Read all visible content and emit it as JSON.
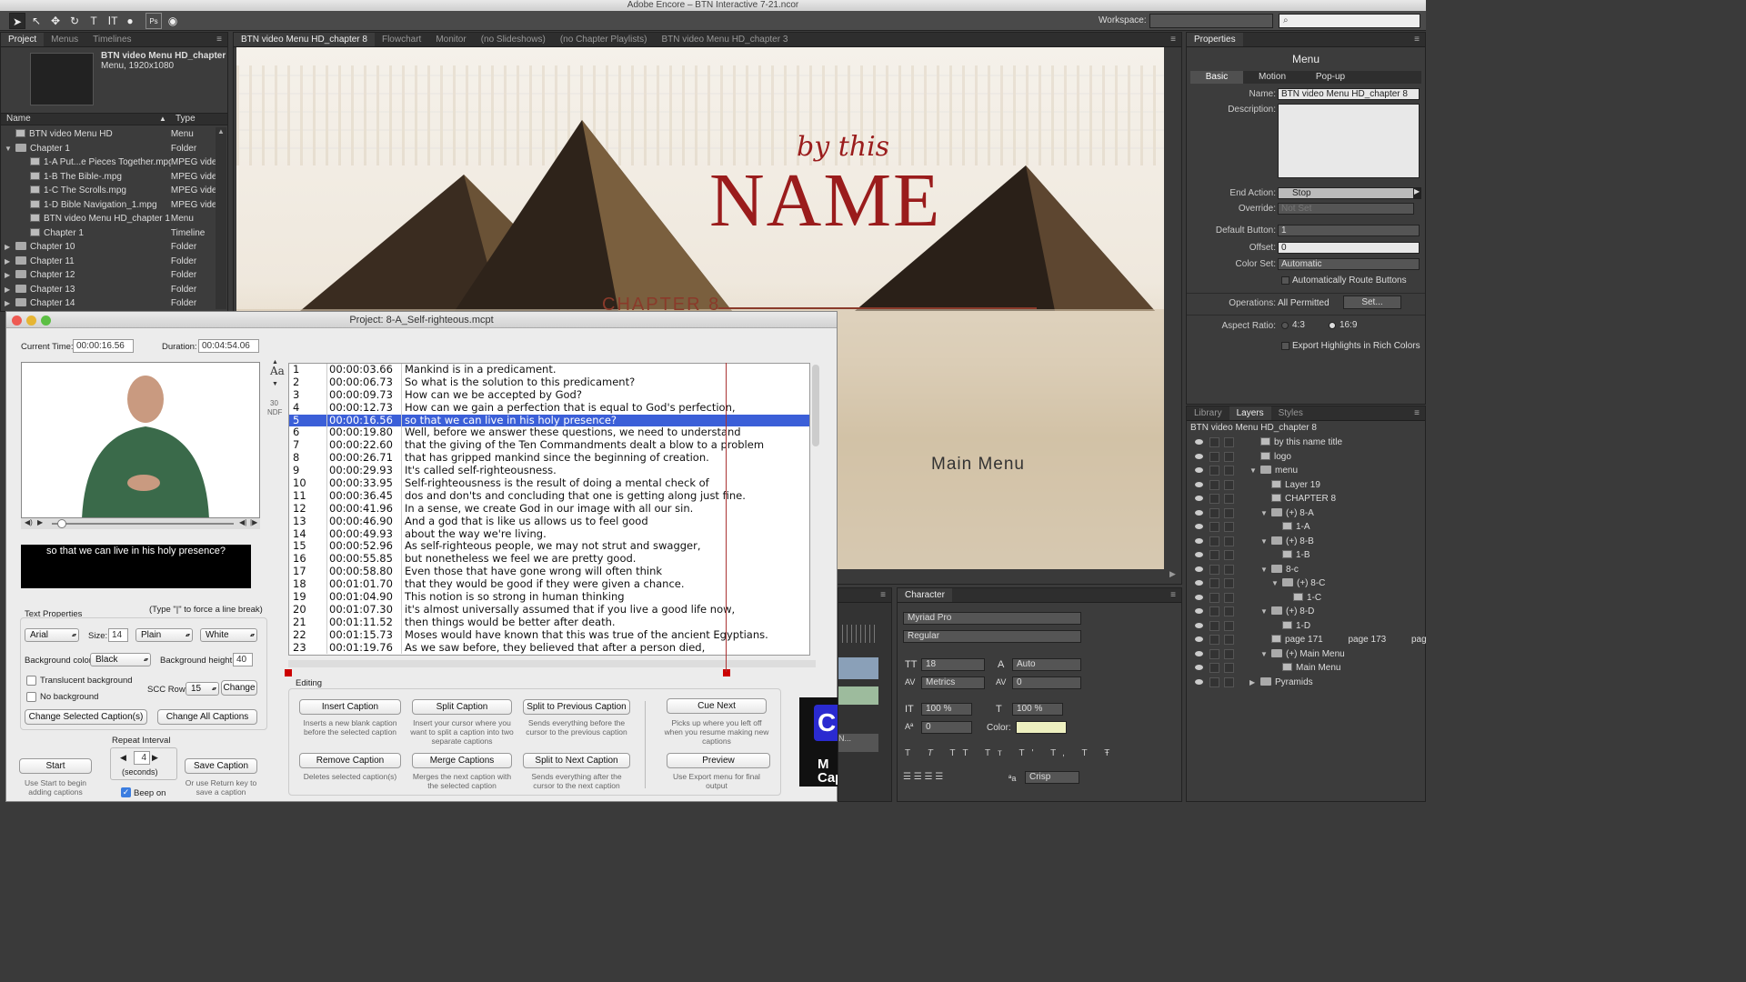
{
  "app": {
    "title": "Adobe Encore – BTN Interactive 7-21.ncor"
  },
  "toolbar": {
    "workspace_label": "Workspace:",
    "tools": [
      "arrow-tool",
      "direct-select",
      "move-tool",
      "rotate",
      "text",
      "vertical-text",
      "zoom",
      "ps",
      "hand"
    ]
  },
  "project_panel": {
    "tabs": [
      "Project",
      "Menus",
      "Timelines"
    ],
    "preview_title": "BTN video Menu HD_chapter ...",
    "preview_sub": "Menu, 1920x1080",
    "col_name": "Name",
    "col_type": "Type",
    "rows": [
      {
        "name": "BTN video Menu HD",
        "type": "Menu",
        "kind": "menu",
        "indent": 0,
        "tri": ""
      },
      {
        "name": "Chapter 1",
        "type": "Folder",
        "kind": "folder",
        "indent": 0,
        "tri": "▼"
      },
      {
        "name": "1-A Put...e Pieces Together.mpg",
        "type": "MPEG vide",
        "kind": "video",
        "indent": 1,
        "tri": ""
      },
      {
        "name": "1-B The Bible-.mpg",
        "type": "MPEG vide",
        "kind": "video",
        "indent": 1,
        "tri": ""
      },
      {
        "name": "1-C The Scrolls.mpg",
        "type": "MPEG vide",
        "kind": "video",
        "indent": 1,
        "tri": ""
      },
      {
        "name": "1-D Bible Navigation_1.mpg",
        "type": "MPEG vide",
        "kind": "video",
        "indent": 1,
        "tri": ""
      },
      {
        "name": "BTN video Menu HD_chapter 1",
        "type": "Menu",
        "kind": "menu",
        "indent": 1,
        "tri": ""
      },
      {
        "name": "Chapter 1",
        "type": "Timeline",
        "kind": "timeline",
        "indent": 1,
        "tri": ""
      },
      {
        "name": "Chapter 10",
        "type": "Folder",
        "kind": "folder",
        "indent": 0,
        "tri": "▶"
      },
      {
        "name": "Chapter 11",
        "type": "Folder",
        "kind": "folder",
        "indent": 0,
        "tri": "▶"
      },
      {
        "name": "Chapter 12",
        "type": "Folder",
        "kind": "folder",
        "indent": 0,
        "tri": "▶"
      },
      {
        "name": "Chapter 13",
        "type": "Folder",
        "kind": "folder",
        "indent": 0,
        "tri": "▶"
      },
      {
        "name": "Chapter 14",
        "type": "Folder",
        "kind": "folder",
        "indent": 0,
        "tri": "▶"
      }
    ]
  },
  "center_tabs": [
    "BTN video Menu HD_chapter 8",
    "Flowchart",
    "Monitor",
    "(no Slideshows)",
    "(no Chapter Playlists)",
    "BTN video Menu HD_chapter 3"
  ],
  "menu_preview": {
    "by_this": "by this",
    "name": "NAME",
    "chapter": "CHAPTER 8",
    "main_menu": "Main Menu"
  },
  "properties": {
    "tab": "Properties",
    "heading": "Menu",
    "subtabs": [
      "Basic",
      "Motion",
      "Pop-up"
    ],
    "name_label": "Name:",
    "name_value": "BTN video Menu HD_chapter 8",
    "description_label": "Description:",
    "end_action_label": "End Action:",
    "end_action_value": "Stop",
    "override_label": "Override:",
    "override_value": "Not Set",
    "default_button_label": "Default Button:",
    "default_button_value": "1",
    "offset_label": "Offset:",
    "offset_value": "0",
    "color_set_label": "Color Set:",
    "color_set_value": "Automatic",
    "auto_route": "Automatically Route Buttons",
    "operations_label": "Operations:",
    "operations_value": "All Permitted",
    "set_button": "Set...",
    "aspect_label": "Aspect Ratio:",
    "aspect_a": "4:3",
    "aspect_b": "16:9",
    "export_highlights": "Export Highlights in Rich Colors"
  },
  "layers": {
    "tabs": [
      "Library",
      "Layers",
      "Styles"
    ],
    "root": "BTN video Menu HD_chapter 8",
    "rows": [
      {
        "label": "by this name title",
        "indent": 0,
        "kind": "img",
        "tri": ""
      },
      {
        "label": "logo",
        "indent": 0,
        "kind": "img",
        "tri": ""
      },
      {
        "label": "menu",
        "indent": 0,
        "kind": "folder",
        "tri": "▼"
      },
      {
        "label": "Layer 19",
        "indent": 1,
        "kind": "img",
        "tri": ""
      },
      {
        "label": "CHAPTER 8",
        "indent": 1,
        "kind": "text",
        "tri": ""
      },
      {
        "label": "(+) 8-A",
        "indent": 1,
        "kind": "folder",
        "tri": "▼"
      },
      {
        "label": "1-A",
        "indent": 2,
        "kind": "text",
        "tri": ""
      },
      {
        "label": "(+) 8-B",
        "indent": 1,
        "kind": "folder",
        "tri": "▼"
      },
      {
        "label": "1-B",
        "indent": 2,
        "kind": "text",
        "tri": ""
      },
      {
        "label": "8-c",
        "indent": 1,
        "kind": "folder",
        "tri": "▼"
      },
      {
        "label": "(+) 8-C",
        "indent": 2,
        "kind": "folder",
        "tri": "▼"
      },
      {
        "label": "1-C",
        "indent": 3,
        "kind": "text",
        "tri": ""
      },
      {
        "label": "(+) 8-D",
        "indent": 1,
        "kind": "folder",
        "tri": "▼"
      },
      {
        "label": "1-D",
        "indent": 2,
        "kind": "text",
        "tri": ""
      },
      {
        "label": "page 171          page 173          pag",
        "indent": 1,
        "kind": "text",
        "tri": ""
      },
      {
        "label": "(+) Main Menu",
        "indent": 1,
        "kind": "folder",
        "tri": "▼"
      },
      {
        "label": "Main Menu",
        "indent": 2,
        "kind": "text",
        "tri": ""
      },
      {
        "label": "Pyramids",
        "indent": 0,
        "kind": "folder",
        "tri": "▶"
      }
    ]
  },
  "character": {
    "tab": "Character",
    "font": "Myriad Pro",
    "style": "Regular",
    "size": "18",
    "leading": "Auto",
    "kerning": "Metrics",
    "tracking": "0",
    "vscale": "100 %",
    "hscale": "100 %",
    "baseline": "0",
    "color_label": "Color:",
    "antialias": "Crisp",
    "aa_label": "ªa",
    "color_swatch": "#eef0c0"
  },
  "caption_tool": {
    "window_title": "Project: 8-A_Self-righteous.mcpt",
    "current_time_label": "Current Time:",
    "current_time": "00:00:16.56",
    "duration_label": "Duration:",
    "duration": "00:04:54.06",
    "preview_caption": "so that we can live in his holy presence?",
    "fps": "30",
    "fps_mode": "NDF",
    "aa": "Aa",
    "text_props_label": "Text Properties",
    "linebreak_hint": "(Type \"|\" to force a line break)",
    "font": "Arial",
    "size_label": "Size:",
    "size": "14",
    "style": "Plain",
    "color": "White",
    "bg_color_label": "Background color",
    "bg_color": "Black",
    "bg_height_label": "Background height",
    "bg_height": "40",
    "translucent": "Translucent background",
    "no_bg": "No background",
    "scc_label": "SCC Row:",
    "scc_row": "15",
    "change": "Change",
    "change_selected": "Change Selected Caption(s)",
    "change_all": "Change All Captions",
    "repeat_label": "Repeat Interval",
    "repeat_value": "4",
    "seconds": "(seconds)",
    "start": "Start",
    "start_hint": "Use Start to begin adding captions",
    "save_caption": "Save Caption",
    "save_hint": "Or use Return key to save a caption",
    "beep": "Beep on",
    "editing_label": "Editing",
    "insert": "Insert Caption",
    "insert_hint": "Inserts a new blank caption before the selected caption",
    "split": "Split Caption",
    "split_hint": "Insert your cursor where you want to split a caption into two separate captions",
    "split_prev": "Split to Previous Caption",
    "split_prev_hint": "Sends everything before the cursor to the previous caption",
    "cue_next": "Cue Next",
    "cue_hint": "Picks up where you left off when you resume making new captions",
    "remove": "Remove Caption",
    "remove_hint": "Deletes selected caption(s)",
    "merge": "Merge Captions",
    "merge_hint": "Merges the next caption with the selected caption",
    "split_next": "Split to Next Caption",
    "split_next_hint": "Sends everything after the cursor to the next caption",
    "preview": "Preview",
    "preview_hint": "Use Export menu for final output",
    "selected_row": 5,
    "captions": [
      {
        "n": "1",
        "t": "00:00:03.66",
        "x": "Mankind is in a predicament."
      },
      {
        "n": "2",
        "t": "00:00:06.73",
        "x": "So what is the solution to this predicament?"
      },
      {
        "n": "3",
        "t": "00:00:09.73",
        "x": "How can we be accepted by God?"
      },
      {
        "n": "4",
        "t": "00:00:12.73",
        "x": "How can we gain a perfection that is equal to God's perfection,"
      },
      {
        "n": "5",
        "t": "00:00:16.56",
        "x": "so that we can live in his holy presence?"
      },
      {
        "n": "6",
        "t": "00:00:19.80",
        "x": "Well, before we answer these questions, we need to understand"
      },
      {
        "n": "7",
        "t": "00:00:22.60",
        "x": "that the giving of the Ten Commandments dealt a blow to a problem"
      },
      {
        "n": "8",
        "t": "00:00:26.71",
        "x": "that has gripped mankind since the beginning of creation."
      },
      {
        "n": "9",
        "t": "00:00:29.93",
        "x": "It's called self-righteousness."
      },
      {
        "n": "10",
        "t": "00:00:33.95",
        "x": "Self-righteousness is the result of doing a mental check of"
      },
      {
        "n": "11",
        "t": "00:00:36.45",
        "x": "dos and don'ts and concluding that one is getting along just fine."
      },
      {
        "n": "12",
        "t": "00:00:41.96",
        "x": "In a sense, we create God in our image with all our sin."
      },
      {
        "n": "13",
        "t": "00:00:46.90",
        "x": "And a god that is like us allows us to feel good"
      },
      {
        "n": "14",
        "t": "00:00:49.93",
        "x": "about the way we're living."
      },
      {
        "n": "15",
        "t": "00:00:52.96",
        "x": "As self-righteous people, we may not strut and swagger,"
      },
      {
        "n": "16",
        "t": "00:00:55.85",
        "x": "but nonetheless we feel we are pretty good."
      },
      {
        "n": "17",
        "t": "00:00:58.80",
        "x": "Even those that have gone wrong will often think"
      },
      {
        "n": "18",
        "t": "00:01:01.70",
        "x": "that they would be good if they were given a chance."
      },
      {
        "n": "19",
        "t": "00:01:04.90",
        "x": "This notion is so strong in human thinking"
      },
      {
        "n": "20",
        "t": "00:01:07.30",
        "x": "it's almost universally assumed that if you live a good life now,"
      },
      {
        "n": "21",
        "t": "00:01:11.52",
        "x": "then things would be better after death."
      },
      {
        "n": "22",
        "t": "00:01:15.73",
        "x": "Moses would have known that this was true of the ancient Egyptians."
      },
      {
        "n": "23",
        "t": "00:01:19.76",
        "x": "As we saw before, they believed that after a person died,"
      }
    ]
  },
  "colors": {
    "accent_selection": "#3b5fd8",
    "title_red": "#9a1c1c",
    "chapter_red": "#8a3a2a"
  }
}
